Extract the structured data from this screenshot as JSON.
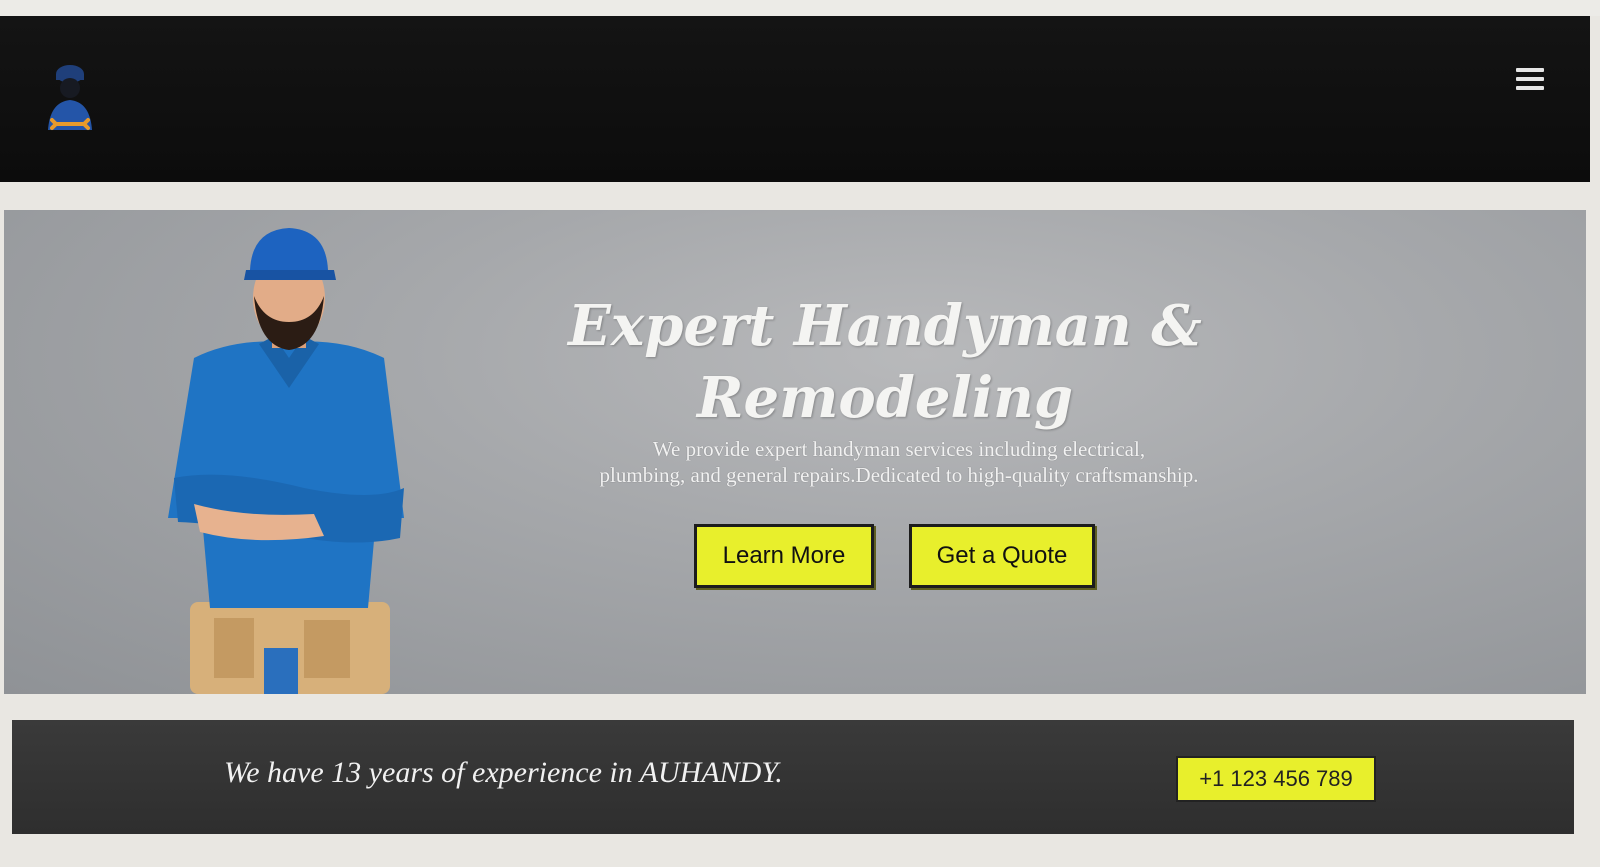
{
  "header": {
    "logo_icon": "handyman-logo-icon",
    "menu_icon": "hamburger-menu-icon"
  },
  "hero": {
    "title_line1": "Expert Handyman &",
    "title_line2": "Remodeling",
    "subtitle_line1": "We provide expert handyman services including electrical,",
    "subtitle_line2": "plumbing, and general repairs.Dedicated to high-quality craftsmanship.",
    "learn_more_label": "Learn More",
    "get_quote_label": "Get a Quote"
  },
  "band": {
    "experience_text": "We have 13 years of experience in AUHANDY.",
    "phone_label": "+1 123 456 789"
  },
  "colors": {
    "accent_yellow": "#e8ef2c",
    "header_bg": "#111111",
    "band_bg": "#333333"
  }
}
